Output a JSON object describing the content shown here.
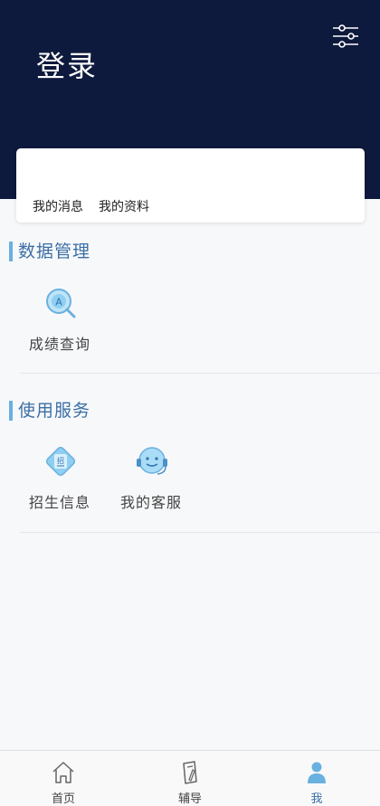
{
  "header": {
    "title": "登录",
    "settings_icon": "settings-sliders-icon"
  },
  "card": {
    "links": [
      "我的消息",
      "我的资料"
    ]
  },
  "sections": [
    {
      "title": "数据管理",
      "items": [
        {
          "label": "成绩查询",
          "icon": "search-score-icon"
        }
      ]
    },
    {
      "title": "使用服务",
      "items": [
        {
          "label": "招生信息",
          "icon": "admission-info-icon"
        },
        {
          "label": "我的客服",
          "icon": "customer-service-icon"
        }
      ]
    }
  ],
  "tabbar": {
    "tabs": [
      {
        "label": "首页",
        "icon": "home-icon",
        "active": false
      },
      {
        "label": "辅导",
        "icon": "book-pencil-icon",
        "active": false
      },
      {
        "label": "我",
        "icon": "user-icon",
        "active": true
      }
    ]
  },
  "colors": {
    "header_bg": "#0e1a3d",
    "accent": "#3b6fa6",
    "section_bar": "#6ab0e0",
    "icon_blue": "#7cc4ef"
  }
}
